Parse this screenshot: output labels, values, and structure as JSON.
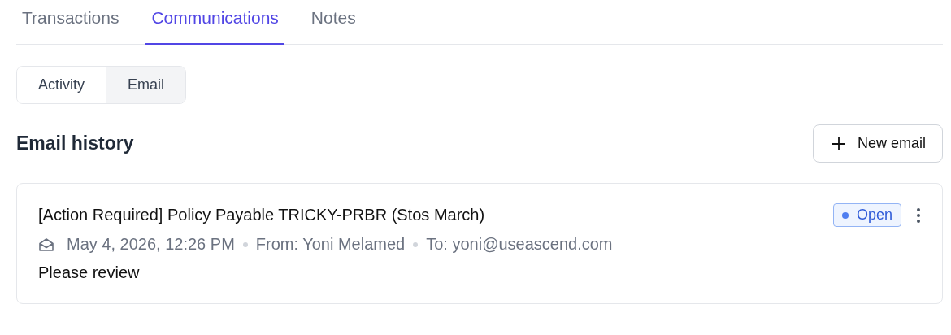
{
  "tabs": [
    {
      "label": "Transactions",
      "selected": false
    },
    {
      "label": "Communications",
      "selected": true
    },
    {
      "label": "Notes",
      "selected": false
    }
  ],
  "view_toggle": [
    {
      "label": "Activity",
      "selected": false
    },
    {
      "label": "Email",
      "selected": true
    }
  ],
  "section": {
    "title": "Email history",
    "action": "New email"
  },
  "emails": [
    {
      "subject": "[Action Required] Policy Payable TRICKY-PRBR (Stos March)",
      "status": {
        "label": "Open",
        "kind": "open"
      },
      "date": "May 4, 2026, 12:26 PM",
      "from": "From: Yoni Melamed",
      "to": "To: yoni@useascend.com",
      "body": "Please review"
    }
  ]
}
